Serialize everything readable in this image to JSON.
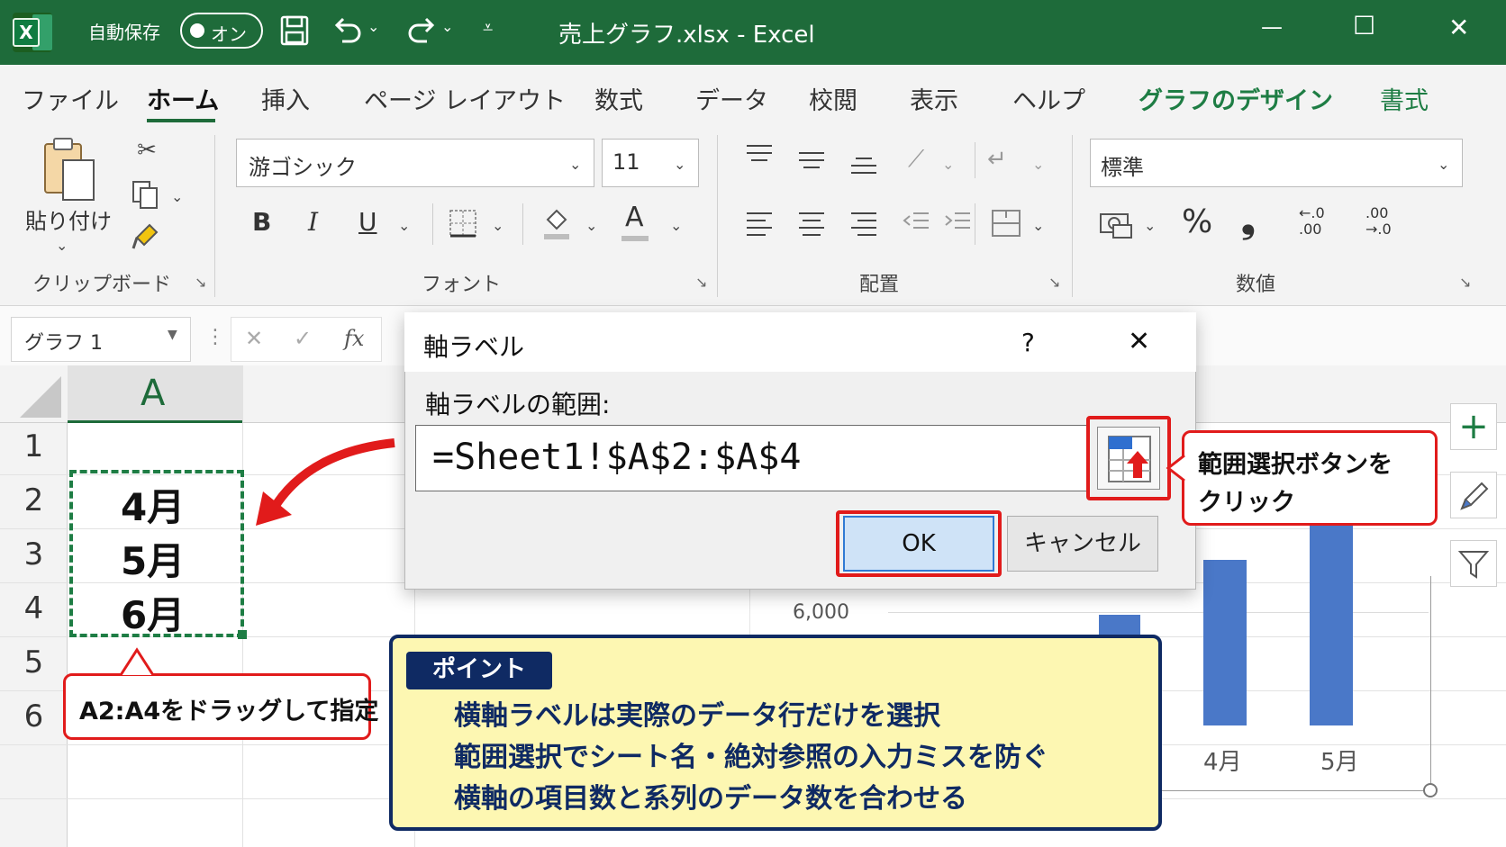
{
  "titlebar": {
    "autosave_label": "自動保存",
    "toggle_label": "オン",
    "document_title": "売上グラフ.xlsx  -  Excel",
    "minimize_glyph": "—",
    "maximize_glyph": "☐",
    "close_glyph": "✕"
  },
  "menu": {
    "tabs": [
      "ファイル",
      "ホーム",
      "挿入",
      "ページ レイアウト",
      "数式",
      "データ",
      "校閲",
      "表示",
      "ヘルプ",
      "グラフのデザイン",
      "書式"
    ],
    "active_tab": "ホーム"
  },
  "ribbon": {
    "clipboard": {
      "paste_label": "貼り付け",
      "group_label": "クリップボード"
    },
    "font": {
      "font_name": "游ゴシック",
      "font_size": "11",
      "bold": "B",
      "italic": "I",
      "underline": "U",
      "font_color_glyph": "A",
      "group_label": "フォント"
    },
    "alignment": {
      "group_label": "配置"
    },
    "number": {
      "format": "標準",
      "percent": "%",
      "comma": "❟",
      "inc_decimal_top": "←.0",
      "inc_decimal_bottom": ".00",
      "dec_decimal_top": ".00",
      "dec_decimal_bottom": "→.0",
      "group_label": "数値"
    }
  },
  "formula_bar": {
    "name_box": "グラフ 1",
    "cancel_glyph": "✕",
    "enter_glyph": "✓",
    "fx_label": "fx"
  },
  "grid": {
    "column_header": "A",
    "row_numbers": [
      "1",
      "2",
      "3",
      "4",
      "5",
      "6"
    ],
    "cells": {
      "A2": "4月",
      "A3": "5月",
      "A4": "6月"
    }
  },
  "dialog": {
    "title": "軸ラベル",
    "help_glyph": "?",
    "close_glyph": "✕",
    "range_label": "軸ラベルの範囲:",
    "range_value": "=Sheet1!$A$2:$A$4",
    "ok_label": "OK",
    "cancel_label": "キャンセル"
  },
  "chart": {
    "y_tick": "6,000",
    "categories": [
      "4月",
      "5月"
    ],
    "bar_color": "#4a78c8"
  },
  "chart_side_buttons": {
    "add_glyph": "+",
    "style_icon": "brush-icon",
    "filter_icon": "filter-icon"
  },
  "annotations": {
    "drag_callout": "A2:A4をドラッグして指定",
    "range_button_callout_line1": "範囲選択ボタンを",
    "range_button_callout_line2": "クリック",
    "point_badge": "ポイント",
    "point_lines": [
      "横軸ラベルは実際のデータ行だけを選択",
      "範囲選択でシート名・絶対参照の入力ミスを防ぐ",
      "横軸の項目数と系列のデータ数を合わせる"
    ],
    "highlight_color": "#e11b1b",
    "point_bg_color": "#fdf7b2",
    "point_border_color": "#0f2a63"
  }
}
